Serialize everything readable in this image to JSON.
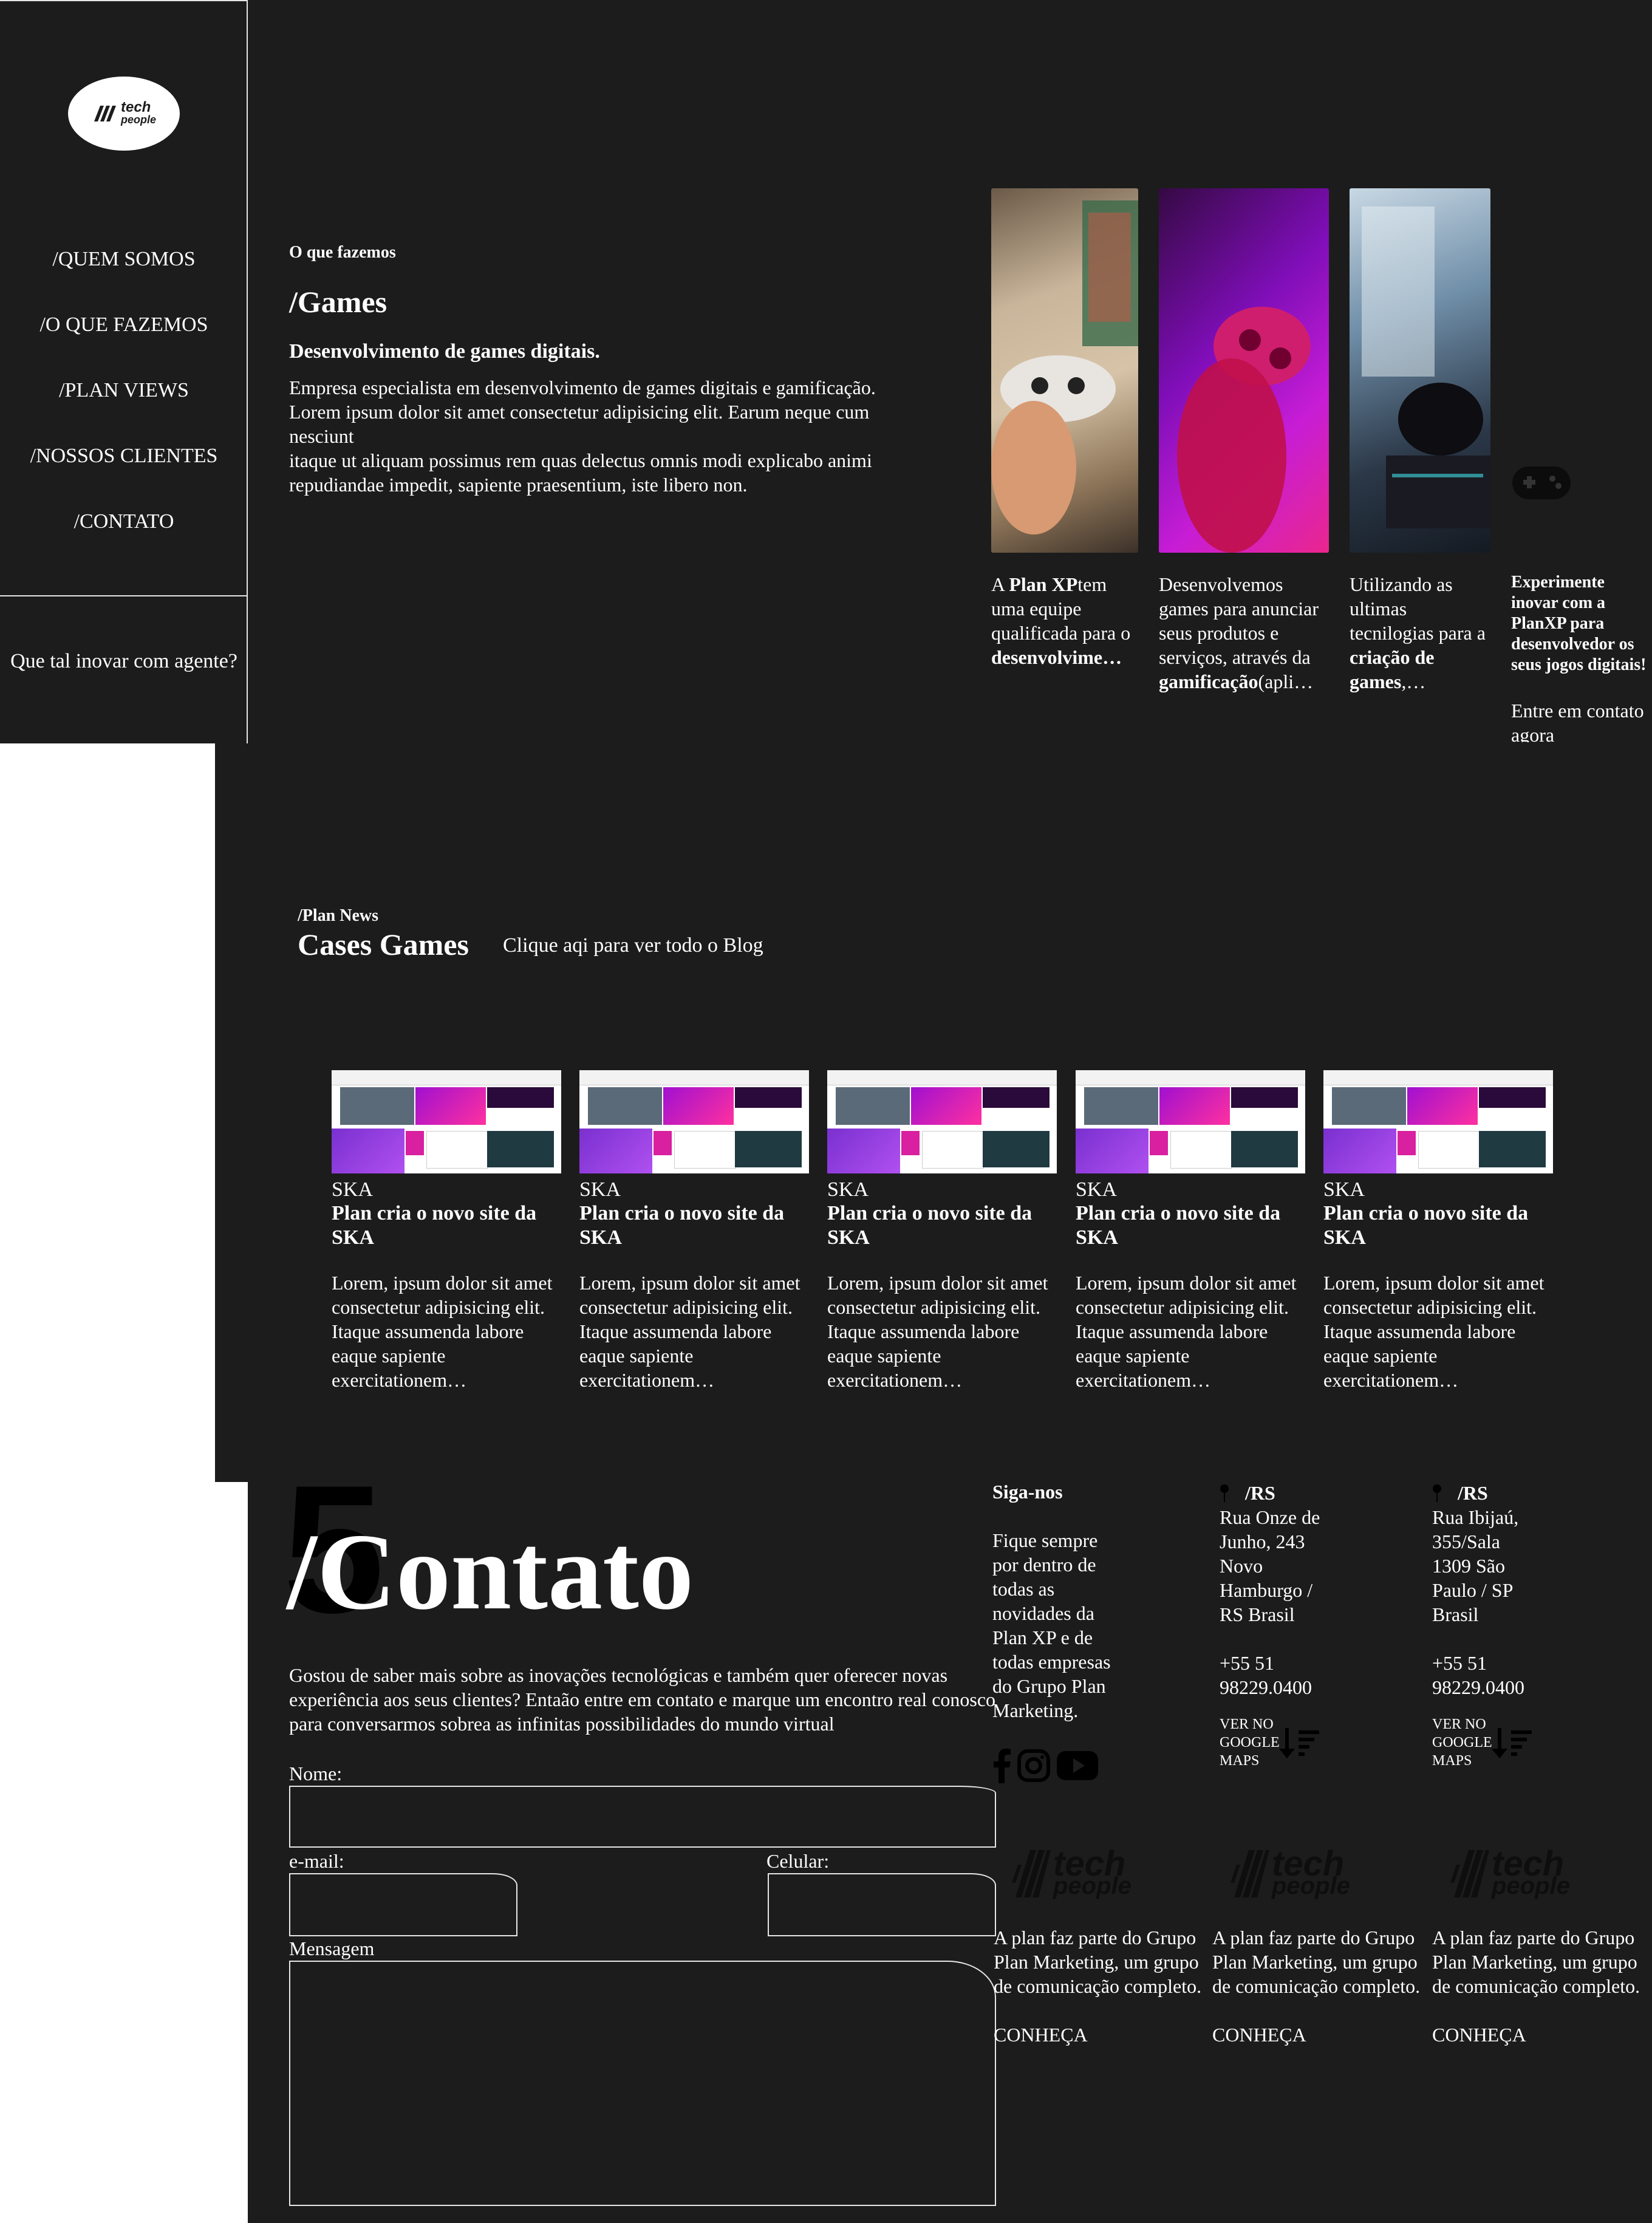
{
  "sidebar": {
    "logo_text_line1": "tech",
    "logo_text_line2": "people",
    "nav": [
      "/QUEM SOMOS",
      "/O QUE FAZEMOS",
      "/PLAN VIEWS",
      "/NOSSOS CLIENTES",
      "/CONTATO"
    ],
    "cta": "Que tal inovar com agente?"
  },
  "games": {
    "eyebrow": "O que fazemos",
    "title": "/Games",
    "subtitle": "Desenvolvimento de games digitais.",
    "body_line1": "Empresa especialista em desenvolvimento de games digitais e gamificação.",
    "body_line2": "Lorem ipsum dolor sit amet consectetur adipisicing elit. Earum neque cum nesciunt",
    "body_line3": "itaque ut aliquam possimus rem quas delectus omnis modi explicabo animi repudiandae impedit, sapiente praesentium, iste libero non.",
    "card1_a": "A ",
    "card1_b": "Plan XP",
    "card1_c": "tem uma equipe qualificada para o ",
    "card1_d": "desenvolvime…",
    "card2_a": "Desenvolvemos games para anunciar seus produtos e serviços, através da ",
    "card2_b": "gamificação",
    "card2_c": "(apli…",
    "card3_a": "Utilizando as ultimas tecnilogias para a ",
    "card3_b": "criação de games",
    "card3_c": ",…",
    "cta_text": "Experimente inovar com a PlanXP para desenvolvedor os seus jogos digitais!",
    "cta_link": "Entre em contato agora"
  },
  "news": {
    "eyebrow": "/Plan News",
    "title": "Cases Games",
    "blog_link": "Clique aqi para ver todo o Blog",
    "cards": [
      {
        "tag": "SKA",
        "title": "Plan cria o novo site da SKA",
        "body": "Lorem, ipsum dolor sit amet consectetur adipisicing elit. Itaque assumenda labore eaque sapiente exercitationem…"
      },
      {
        "tag": "SKA",
        "title": "Plan cria o novo site da SKA",
        "body": "Lorem, ipsum dolor sit amet consectetur adipisicing elit. Itaque assumenda labore eaque sapiente exercitationem…"
      },
      {
        "tag": "SKA",
        "title": "Plan cria o novo site da SKA",
        "body": "Lorem, ipsum dolor sit amet consectetur adipisicing elit. Itaque assumenda labore eaque sapiente exercitationem…"
      },
      {
        "tag": "SKA",
        "title": "Plan cria o novo site da SKA",
        "body": "Lorem, ipsum dolor sit amet consectetur adipisicing elit. Itaque assumenda labore eaque sapiente exercitationem…"
      },
      {
        "tag": "SKA",
        "title": "Plan cria o novo site da SKA",
        "body": "Lorem, ipsum dolor sit amet consectetur adipisicing elit. Itaque assumenda labore eaque sapiente exercitationem…"
      }
    ]
  },
  "contact": {
    "big_number": "5",
    "title": "/Contato",
    "intro_line1": "Gostou de saber mais sobre as inovações tecnológicas e também quer oferecer novas experiência aos seus clientes? Entaão entre em contato e marque um encontro real conosco",
    "intro_line2": "para conversarmos sobrea as infinitas possibilidades do mundo virtual",
    "label_name": "Nome:",
    "label_email": "e-mail:",
    "label_phone": "Celular:",
    "label_message": "Mensagem",
    "follow_title": "Siga-nos",
    "follow_text": "Fique sempre por dentro de todas as novidades da Plan XP e de todas empresas do Grupo Plan Marketing.",
    "offices": [
      {
        "city": "/RS",
        "address": "Rua Onze de Junho, 243 Novo Hamburgo / RS Brasil",
        "phone": "+55 51 98229.0400",
        "map_link": "VER NO GOOGLE MAPS"
      },
      {
        "city": "/RS",
        "address": "Rua Ibijaú, 355/Sala 1309 São Paulo / SP Brasil",
        "phone": "+55 51 98229.0400",
        "map_link": "VER NO GOOGLE MAPS"
      }
    ],
    "partners": [
      {
        "logo1": "tech",
        "logo2": "people",
        "text": "A plan faz parte do Grupo Plan Marketing, um grupo de comunicação completo.",
        "link": "CONHEÇA"
      },
      {
        "logo1": "tech",
        "logo2": "people",
        "text": "A plan faz parte do Grupo Plan Marketing, um grupo de comunicação completo.",
        "link": "CONHEÇA"
      },
      {
        "logo1": "tech",
        "logo2": "people",
        "text": "A plan faz parte do Grupo Plan Marketing, um grupo de comunicação completo.",
        "link": "CONHEÇA"
      }
    ]
  }
}
